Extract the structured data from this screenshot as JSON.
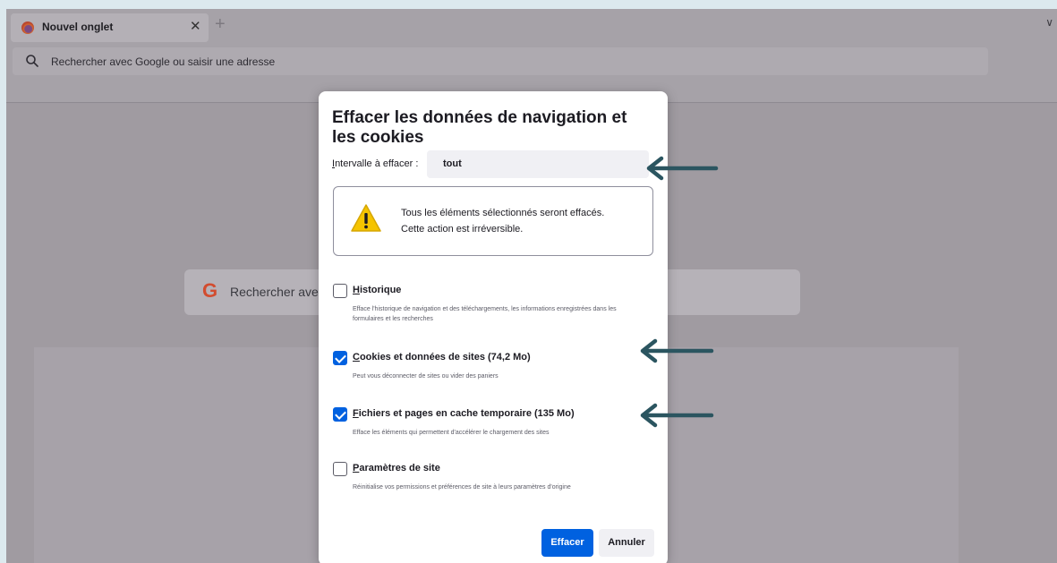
{
  "browser": {
    "tab_title": "Nouvel onglet",
    "tab_close_icon": "close-icon",
    "new_tab_symbol": "+",
    "tab_list_symbol": "∨",
    "url_placeholder": "Rechercher avec Google ou saisir une adresse"
  },
  "new_tab_page": {
    "search_logo": "G",
    "search_placeholder": "Rechercher avec"
  },
  "dialog": {
    "title": "Effacer les données de navigation et les cookies",
    "range_label_first": "I",
    "range_label_rest": "ntervalle à effacer :",
    "range_value": "tout",
    "warning_line1": "Tous les éléments sélectionnés seront effacés.",
    "warning_line2": "Cette action est irréversible.",
    "options": [
      {
        "label_first": "H",
        "label_rest": "istorique",
        "checked": false,
        "description": "Efface l'historique de navigation et des téléchargements, les informations enregistrées dans les formulaires et les recherches"
      },
      {
        "label_first": "C",
        "label_rest": "ookies et données de sites (74,2 Mo)",
        "checked": true,
        "description": "Peut vous déconnecter de sites ou vider des paniers"
      },
      {
        "label_first": "F",
        "label_rest": "ichiers et pages en cache temporaire (135 Mo)",
        "checked": true,
        "description": "Efface les éléments qui permettent d'accélérer le chargement des sites"
      },
      {
        "label_first": "P",
        "label_rest": "aramètres de site",
        "checked": false,
        "description": "Réinitialise vos permissions et préférences de site à leurs paramètres d'origine"
      }
    ],
    "clear_button": "Effacer",
    "cancel_button": "Annuler"
  },
  "colors": {
    "accent": "#0061e0",
    "annotation_arrow": "#2b5560",
    "page_background": "#dce9ee"
  }
}
